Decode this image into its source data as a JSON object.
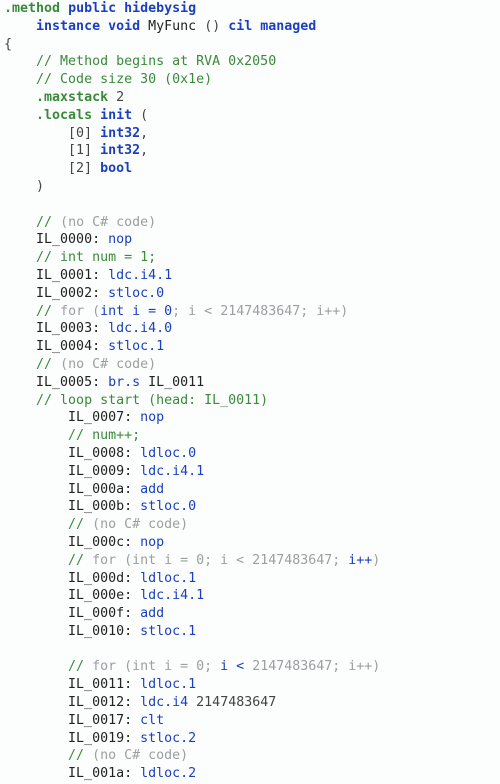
{
  "lines": [
    {
      "i": 0,
      "spans": [
        {
          "c": "dir",
          "t": ".method"
        },
        {
          "c": "pn",
          "t": " "
        },
        {
          "c": "kw",
          "t": "public"
        },
        {
          "c": "pn",
          "t": " "
        },
        {
          "c": "kw",
          "t": "hidebysig"
        }
      ]
    },
    {
      "i": 1,
      "spans": [
        {
          "c": "kw",
          "t": "instance"
        },
        {
          "c": "pn",
          "t": " "
        },
        {
          "c": "kw",
          "t": "void"
        },
        {
          "c": "pn",
          "t": " "
        },
        {
          "c": "fn",
          "t": "MyFunc"
        },
        {
          "c": "pn",
          "t": " () "
        },
        {
          "c": "kw",
          "t": "cil"
        },
        {
          "c": "pn",
          "t": " "
        },
        {
          "c": "kw",
          "t": "managed"
        }
      ]
    },
    {
      "i": 0,
      "spans": [
        {
          "c": "pn",
          "t": "{"
        }
      ]
    },
    {
      "i": 1,
      "spans": [
        {
          "c": "cm",
          "t": "// Method begins at RVA 0x2050"
        }
      ]
    },
    {
      "i": 1,
      "spans": [
        {
          "c": "cm",
          "t": "// Code size 30 (0x1e)"
        }
      ]
    },
    {
      "i": 1,
      "spans": [
        {
          "c": "dir",
          "t": ".maxstack"
        },
        {
          "c": "pn",
          "t": " "
        },
        {
          "c": "num",
          "t": "2"
        }
      ]
    },
    {
      "i": 1,
      "spans": [
        {
          "c": "dir",
          "t": ".locals"
        },
        {
          "c": "pn",
          "t": " "
        },
        {
          "c": "kw",
          "t": "init"
        },
        {
          "c": "pn",
          "t": " ("
        }
      ]
    },
    {
      "i": 2,
      "spans": [
        {
          "c": "pn",
          "t": "[0] "
        },
        {
          "c": "kw",
          "t": "int32"
        },
        {
          "c": "pn",
          "t": ","
        }
      ]
    },
    {
      "i": 2,
      "spans": [
        {
          "c": "pn",
          "t": "[1] "
        },
        {
          "c": "kw",
          "t": "int32"
        },
        {
          "c": "pn",
          "t": ","
        }
      ]
    },
    {
      "i": 2,
      "spans": [
        {
          "c": "pn",
          "t": "[2] "
        },
        {
          "c": "kw",
          "t": "bool"
        }
      ]
    },
    {
      "i": 1,
      "spans": [
        {
          "c": "pn",
          "t": ")"
        }
      ]
    },
    {
      "i": 1,
      "spans": [
        {
          "c": "pn",
          "t": " "
        }
      ]
    },
    {
      "i": 1,
      "spans": [
        {
          "c": "cm",
          "t": "// "
        },
        {
          "c": "cmg",
          "t": "(no C# code)"
        }
      ]
    },
    {
      "i": 1,
      "spans": [
        {
          "c": "lbl",
          "t": "IL_0000: "
        },
        {
          "c": "op",
          "t": "nop"
        }
      ]
    },
    {
      "i": 1,
      "spans": [
        {
          "c": "cm",
          "t": "// int num = 1;"
        }
      ]
    },
    {
      "i": 1,
      "spans": [
        {
          "c": "lbl",
          "t": "IL_0001: "
        },
        {
          "c": "op",
          "t": "ldc.i4.1"
        }
      ]
    },
    {
      "i": 1,
      "spans": [
        {
          "c": "lbl",
          "t": "IL_0002: "
        },
        {
          "c": "op",
          "t": "stloc.0"
        }
      ]
    },
    {
      "i": 1,
      "spans": [
        {
          "c": "cm",
          "t": "// "
        },
        {
          "c": "cmg",
          "t": "for ("
        },
        {
          "c": "cmb",
          "t": "int i = 0"
        },
        {
          "c": "cmg",
          "t": "; i < 2147483647; i++)"
        }
      ]
    },
    {
      "i": 1,
      "spans": [
        {
          "c": "lbl",
          "t": "IL_0003: "
        },
        {
          "c": "op",
          "t": "ldc.i4.0"
        }
      ]
    },
    {
      "i": 1,
      "spans": [
        {
          "c": "lbl",
          "t": "IL_0004: "
        },
        {
          "c": "op",
          "t": "stloc.1"
        }
      ]
    },
    {
      "i": 1,
      "spans": [
        {
          "c": "cm",
          "t": "// "
        },
        {
          "c": "cmg",
          "t": "(no C# code)"
        }
      ]
    },
    {
      "i": 1,
      "spans": [
        {
          "c": "lbl",
          "t": "IL_0005: "
        },
        {
          "c": "op",
          "t": "br.s"
        },
        {
          "c": "pn",
          "t": " "
        },
        {
          "c": "lbl",
          "t": "IL_0011"
        }
      ]
    },
    {
      "i": 1,
      "spans": [
        {
          "c": "cm",
          "t": "// loop start (head: IL_0011)"
        }
      ]
    },
    {
      "i": 2,
      "spans": [
        {
          "c": "lbl",
          "t": "IL_0007: "
        },
        {
          "c": "op",
          "t": "nop"
        }
      ]
    },
    {
      "i": 2,
      "spans": [
        {
          "c": "cm",
          "t": "// num++;"
        }
      ]
    },
    {
      "i": 2,
      "spans": [
        {
          "c": "lbl",
          "t": "IL_0008: "
        },
        {
          "c": "op",
          "t": "ldloc.0"
        }
      ]
    },
    {
      "i": 2,
      "spans": [
        {
          "c": "lbl",
          "t": "IL_0009: "
        },
        {
          "c": "op",
          "t": "ldc.i4.1"
        }
      ]
    },
    {
      "i": 2,
      "spans": [
        {
          "c": "lbl",
          "t": "IL_000a: "
        },
        {
          "c": "op",
          "t": "add"
        }
      ]
    },
    {
      "i": 2,
      "spans": [
        {
          "c": "lbl",
          "t": "IL_000b: "
        },
        {
          "c": "op",
          "t": "stloc.0"
        }
      ]
    },
    {
      "i": 2,
      "spans": [
        {
          "c": "cm",
          "t": "// "
        },
        {
          "c": "cmg",
          "t": "(no C# code)"
        }
      ]
    },
    {
      "i": 2,
      "spans": [
        {
          "c": "lbl",
          "t": "IL_000c: "
        },
        {
          "c": "op",
          "t": "nop"
        }
      ]
    },
    {
      "i": 2,
      "spans": [
        {
          "c": "cm",
          "t": "// "
        },
        {
          "c": "cmg",
          "t": "for (int i = 0; i < 2147483647; "
        },
        {
          "c": "cmb",
          "t": "i++"
        },
        {
          "c": "cmg",
          "t": ")"
        }
      ]
    },
    {
      "i": 2,
      "spans": [
        {
          "c": "lbl",
          "t": "IL_000d: "
        },
        {
          "c": "op",
          "t": "ldloc.1"
        }
      ]
    },
    {
      "i": 2,
      "spans": [
        {
          "c": "lbl",
          "t": "IL_000e: "
        },
        {
          "c": "op",
          "t": "ldc.i4.1"
        }
      ]
    },
    {
      "i": 2,
      "spans": [
        {
          "c": "lbl",
          "t": "IL_000f: "
        },
        {
          "c": "op",
          "t": "add"
        }
      ]
    },
    {
      "i": 2,
      "spans": [
        {
          "c": "lbl",
          "t": "IL_0010: "
        },
        {
          "c": "op",
          "t": "stloc.1"
        }
      ]
    },
    {
      "i": 2,
      "spans": [
        {
          "c": "pn",
          "t": " "
        }
      ]
    },
    {
      "i": 2,
      "spans": [
        {
          "c": "cm",
          "t": "// "
        },
        {
          "c": "cmg",
          "t": "for (int i = 0; "
        },
        {
          "c": "cmb",
          "t": "i < "
        },
        {
          "c": "cmg",
          "t": "2147483647"
        },
        {
          "c": "cmg",
          "t": "; i++)"
        }
      ]
    },
    {
      "i": 2,
      "spans": [
        {
          "c": "lbl",
          "t": "IL_0011: "
        },
        {
          "c": "op",
          "t": "ldloc.1"
        }
      ]
    },
    {
      "i": 2,
      "spans": [
        {
          "c": "lbl",
          "t": "IL_0012: "
        },
        {
          "c": "op",
          "t": "ldc.i4"
        },
        {
          "c": "pn",
          "t": " "
        },
        {
          "c": "num",
          "t": "2147483647"
        }
      ]
    },
    {
      "i": 2,
      "spans": [
        {
          "c": "lbl",
          "t": "IL_0017: "
        },
        {
          "c": "op",
          "t": "clt"
        }
      ]
    },
    {
      "i": 2,
      "spans": [
        {
          "c": "lbl",
          "t": "IL_0019: "
        },
        {
          "c": "op",
          "t": "stloc.2"
        }
      ]
    },
    {
      "i": 2,
      "spans": [
        {
          "c": "cm",
          "t": "// "
        },
        {
          "c": "cmg",
          "t": "(no C# code)"
        }
      ]
    },
    {
      "i": 2,
      "spans": [
        {
          "c": "lbl",
          "t": "IL_001a: "
        },
        {
          "c": "op",
          "t": "ldloc.2"
        }
      ]
    }
  ],
  "indent_unit": "    "
}
